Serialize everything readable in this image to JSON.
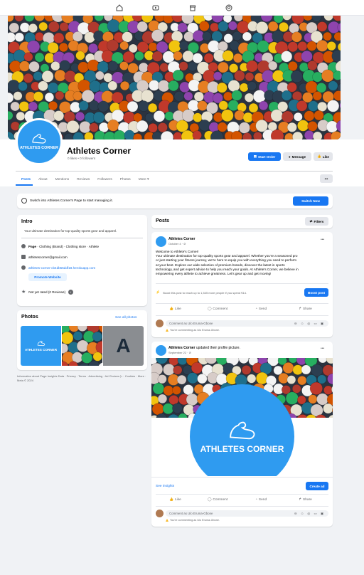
{
  "colors": {
    "accent": "#1877f2",
    "brand": "#2f9bf0"
  },
  "topnav": {
    "icons": [
      "home-icon",
      "video-icon",
      "marketplace-icon",
      "groups-icon"
    ]
  },
  "page": {
    "name": "Athletes Corner",
    "stats": "0 likes • 0 followers",
    "logo_text": "ATHLETES CORNER"
  },
  "actions": {
    "start_order": "Start Order",
    "message": "Message",
    "like": "Like",
    "more": "•••"
  },
  "tabs": [
    "Posts",
    "About",
    "Mentions",
    "Reviews",
    "Followers",
    "Photos",
    "More ▾"
  ],
  "switch": {
    "text": "Switch into Athletes Corner's Page to start managing it.",
    "button": "Switch Now"
  },
  "intro": {
    "title": "Intro",
    "bio": "Your ultimate destination for top-quality sports gear and apparel.",
    "category_bold": "Page",
    "category": " · Clothing (Brand) · Clothing store · Athlete",
    "email": "athletescorner@gmail.com",
    "website": "athletes-corner-cb4db55ddf18.herokuapp.com",
    "promote": "Promote Website",
    "rating": "Not yet rated (0 Reviews)",
    "rating_info": "i"
  },
  "photos": {
    "title": "Photos",
    "see_all": "See all photos",
    "tile_letter": "A",
    "tile_logo": "ATHLETES CORNER"
  },
  "footer": "Information about Page Insights Data · Privacy · Terms · Advertising · Ad Choices ▷ · Cookies · More · Meta © 2024",
  "posts_header": {
    "title": "Posts",
    "filters": "Filters"
  },
  "post1": {
    "author": "Athletes Corner",
    "date": "October 4 · ⊘",
    "menu": "•••",
    "text_lines": [
      "Welcome to Athlete's Corner!",
      "Your ultimate destination for top-quality sports gear and apparel. Whether you're a seasoned pro",
      "or just starting your fitness journey, we're here to equip you with everything you need to perform",
      "at your best. Explore our wide selection of premium brands, discover the latest in sports",
      "technology, and get expert advice to help you reach your goals. At Athlete's Corner, we believe in",
      "empowering every athlete to achieve greatness. Let's gear up and get moving!"
    ],
    "boost_text": "Boost this post to reach up to 1,545 more people if you spend €14.",
    "boost_btn": "Boost post",
    "like": "Like",
    "comment": "Comment",
    "send": "Send",
    "share": "Share",
    "comment_placeholder": "Comment as Ulo Eruma-Gbone",
    "warning": "You're commenting as Ulo Eruma-Gbone."
  },
  "post2": {
    "author": "Athletes Corner",
    "action_text": " updated their profile picture.",
    "date": "September 22 · ⊘",
    "menu": "•••",
    "logo_text": "ATHLETES CORNER",
    "insights": "See insights",
    "create_ad": "Create ad",
    "like": "Like",
    "comment": "Comment",
    "send": "Send",
    "share": "Share",
    "comment_placeholder": "Comment as Ulo Eruma-Gbone",
    "warning": "You're commenting as Ulo Eruma-Gbone."
  }
}
